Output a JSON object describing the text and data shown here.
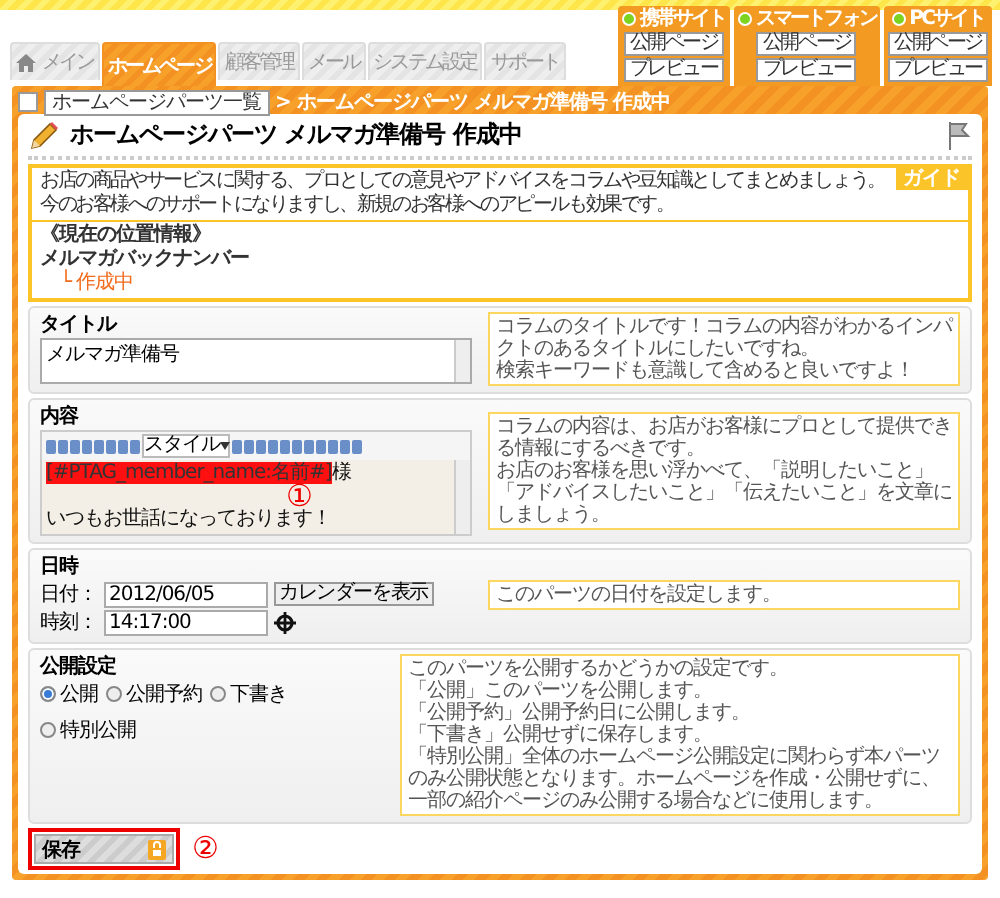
{
  "top_tabs": [
    {
      "label": "メイン",
      "selected": false
    },
    {
      "label": "ホームページ",
      "selected": true
    },
    {
      "label": "顧客管理",
      "selected": false
    },
    {
      "label": "メール",
      "selected": false
    },
    {
      "label": "システム設定",
      "selected": false
    },
    {
      "label": "サポート",
      "selected": false
    }
  ],
  "site_panels": [
    {
      "label": "携帯サイト",
      "buttons": [
        "公開ページ",
        "プレビュー"
      ]
    },
    {
      "label": "スマートフォン",
      "buttons": [
        "公開ページ",
        "プレビュー"
      ]
    },
    {
      "label": "PCサイト",
      "buttons": [
        "公開ページ",
        "プレビュー"
      ]
    }
  ],
  "breadcrumb": {
    "link": "ホームページパーツ一覧",
    "separator": ">",
    "current": "ホームページパーツ メルマガ準備号 作成中"
  },
  "page_title": "ホームページパーツ メルマガ準備号 作成中",
  "guide": {
    "badge": "ガイド",
    "lines": [
      "お店の商品やサービスに関する、プロとしての意見やアドバイスをコラムや豆知識としてまとめましょう。",
      "今のお客様へのサポートになりますし、新規のお客様へのアピールも効果です。"
    ],
    "location_heading": "《現在の位置情報》",
    "location_parent": "メルマガバックナンバー",
    "location_current": "└ 作成中"
  },
  "title_section": {
    "heading": "タイトル",
    "value": "メルマガ準備号",
    "tip": [
      "コラムのタイトルです！コラムの内容がわかるインパクトのあるタイトルにしたいですね。",
      "検索キーワードも意識して含めると良いですよ！"
    ]
  },
  "content_section": {
    "heading": "内容",
    "style_select": "スタイル",
    "marker": "①",
    "body_lines": [
      [
        {
          "text": "[#PTAG_member_name:名前#]",
          "highlighted": true
        },
        {
          "text": "様",
          "highlighted": false
        }
      ],
      [
        {
          "text": "いつもお世話になっております！",
          "highlighted": false
        }
      ]
    ],
    "tip": [
      "コラムの内容は、お店がお客様にプロとして提供できる情報にするべきです。",
      "お店のお客様を思い浮かべて、「説明したいこと」「アドバイスしたいこと」「伝えたいこと」を文章にしましょう。"
    ]
  },
  "date_section": {
    "heading": "日時",
    "fields": [
      {
        "label": "日付：",
        "value": "2012/06/05"
      },
      {
        "label": "時刻：",
        "value": "14:17:00"
      }
    ],
    "calendar_button": "カレンダーを表示",
    "tip": [
      "このパーツの日付を設定します。"
    ]
  },
  "publish_section": {
    "heading": "公開設定",
    "options": [
      {
        "label": "公開",
        "selected": true
      },
      {
        "label": "公開予約",
        "selected": false
      },
      {
        "label": "下書き",
        "selected": false
      },
      {
        "label": "特別公開",
        "selected": false
      }
    ],
    "tip": [
      "このパーツを公開するかどうかの設定です。",
      "「公開」このパーツを公開します。",
      "「公開予約」公開予約日に公開します。",
      "「下書き」公開せずに保存します。",
      "「特別公開」全体のホームページ公開設定に関わらず本パーツのみ公開状態となります。ホームページを作成・公開せずに、一部の紹介ページのみ公開する場合などに使用します。"
    ]
  },
  "save_button": {
    "label": "保存",
    "marker": "②"
  }
}
